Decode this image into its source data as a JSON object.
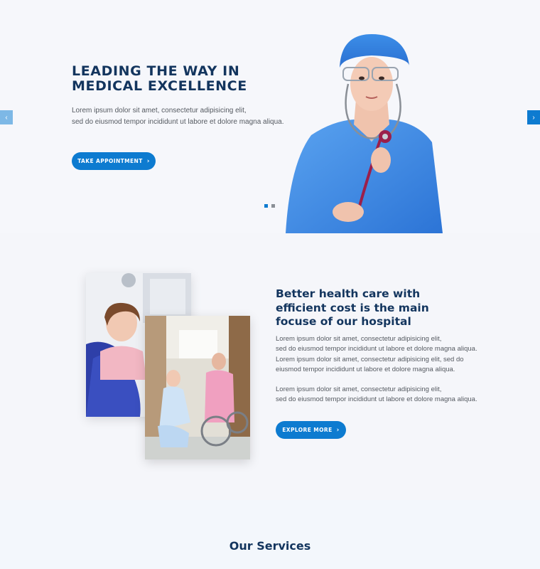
{
  "hero": {
    "title": "LEADING THE WAY IN MEDICAL EXCELLENCE",
    "text_line1": "Lorem ipsum dolor sit amet, consectetur adipisicing elit,",
    "text_line2": "sed do eiusmod tempor incididunt ut labore et dolore magna aliqua.",
    "button_label": "TAKE APPOINTMENT",
    "button_icon": "chevron-right-icon",
    "prev_arrow": "‹",
    "next_arrow": "›",
    "slides_total": 2,
    "slide_active": 1
  },
  "about": {
    "title": "Better health care with efficient cost is the main focuse of our hospital",
    "p1_line1": "Lorem ipsum dolor sit amet, consectetur adipisicing elit,",
    "p1_line2": "sed do eiusmod tempor incididunt ut labore et dolore magna aliqua.",
    "p1_line3": "Lorem ipsum dolor sit amet, consectetur adipisicing elit, sed do",
    "p1_line4": "eiusmod tempor incididunt ut labore et dolore magna aliqua.",
    "p2_line1": "Lorem ipsum dolor sit amet, consectetur adipisicing elit,",
    "p2_line2": "sed do eiusmod tempor incididunt ut labore et dolore magna aliqua.",
    "button_label": "EXPLORE MORE",
    "button_icon": "chevron-right-icon"
  },
  "services": {
    "title": "Our Services"
  },
  "colors": {
    "primary": "#0d7bd0",
    "heading": "#13355e",
    "background": "#f6f7fb"
  }
}
